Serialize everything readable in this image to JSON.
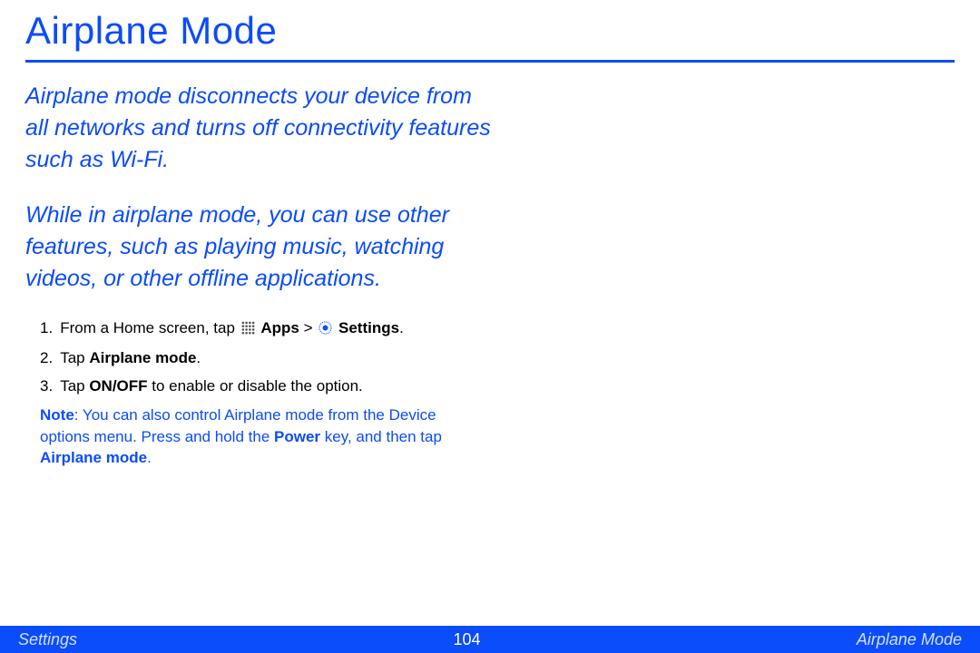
{
  "title": "Airplane Mode",
  "intro": {
    "p1": "Airplane mode disconnects your device from all networks and turns off connectivity features such as Wi-Fi.",
    "p2": "While in airplane mode, you can use other features, such as playing music, watching videos, or other offline applications."
  },
  "steps": {
    "s1": {
      "num": "1.",
      "pre": "From a Home screen, tap ",
      "apps": "Apps",
      "gt": " > ",
      "settings": "Settings",
      "post": "."
    },
    "s2": {
      "num": "2.",
      "pre": "Tap ",
      "airplane": "Airplane mode",
      "post": "."
    },
    "s3": {
      "num": "3.",
      "pre": "Tap ",
      "onoff": "ON/OFF",
      "post": " to enable or disable the option."
    }
  },
  "note": {
    "label": "Note",
    "t1": ": You can also control Airplane mode from the Device options menu. Press and hold the ",
    "power": "Power",
    "t2": " key, and then tap ",
    "airplane": "Airplane mode",
    "t3": "."
  },
  "footer": {
    "left": "Settings",
    "center": "104",
    "right": "Airplane Mode"
  }
}
